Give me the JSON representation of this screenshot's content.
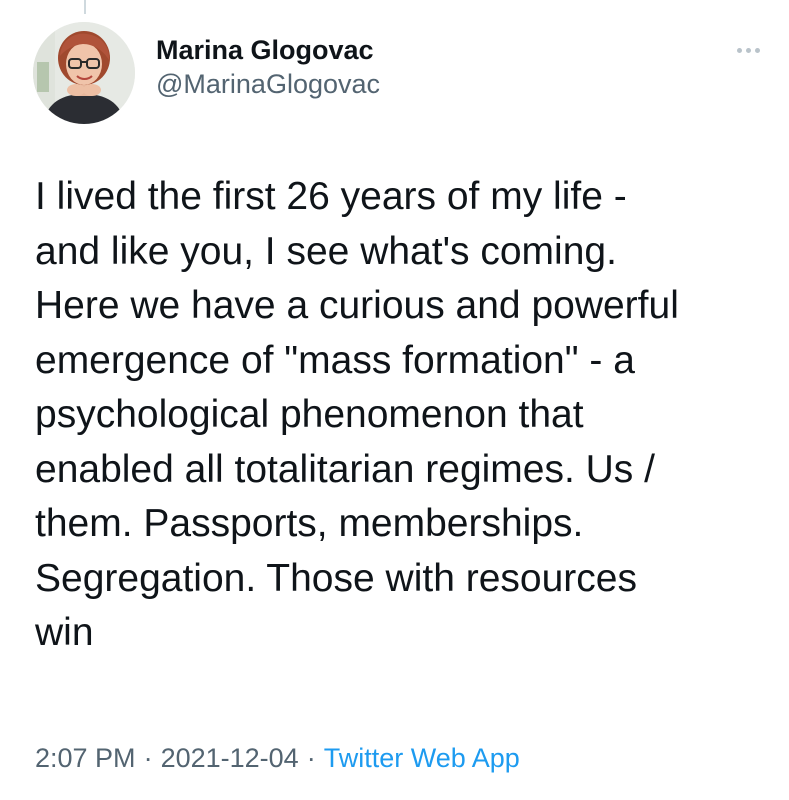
{
  "tweet": {
    "author": {
      "display_name": "Marina Glogovac",
      "handle": "@MarinaGlogovac"
    },
    "text": "I lived the first 26 years of my life -\nand like you, I see what's coming.\nHere we have a curious and powerful\nemergence of \"mass formation\" - a\npsychological phenomenon that\nenabled all totalitarian regimes. Us /\nthem. Passports, memberships.\nSegregation. Those with resources\nwin",
    "time": "2:07 PM",
    "date": "2021-12-04",
    "separator": "·",
    "source": "Twitter Web App"
  },
  "icons": {
    "more": "more-horizontal-icon"
  },
  "colors": {
    "text_primary": "#0f1419",
    "text_secondary": "#536471",
    "link": "#1d9bf0",
    "more_dots": "#b9c3ca"
  }
}
